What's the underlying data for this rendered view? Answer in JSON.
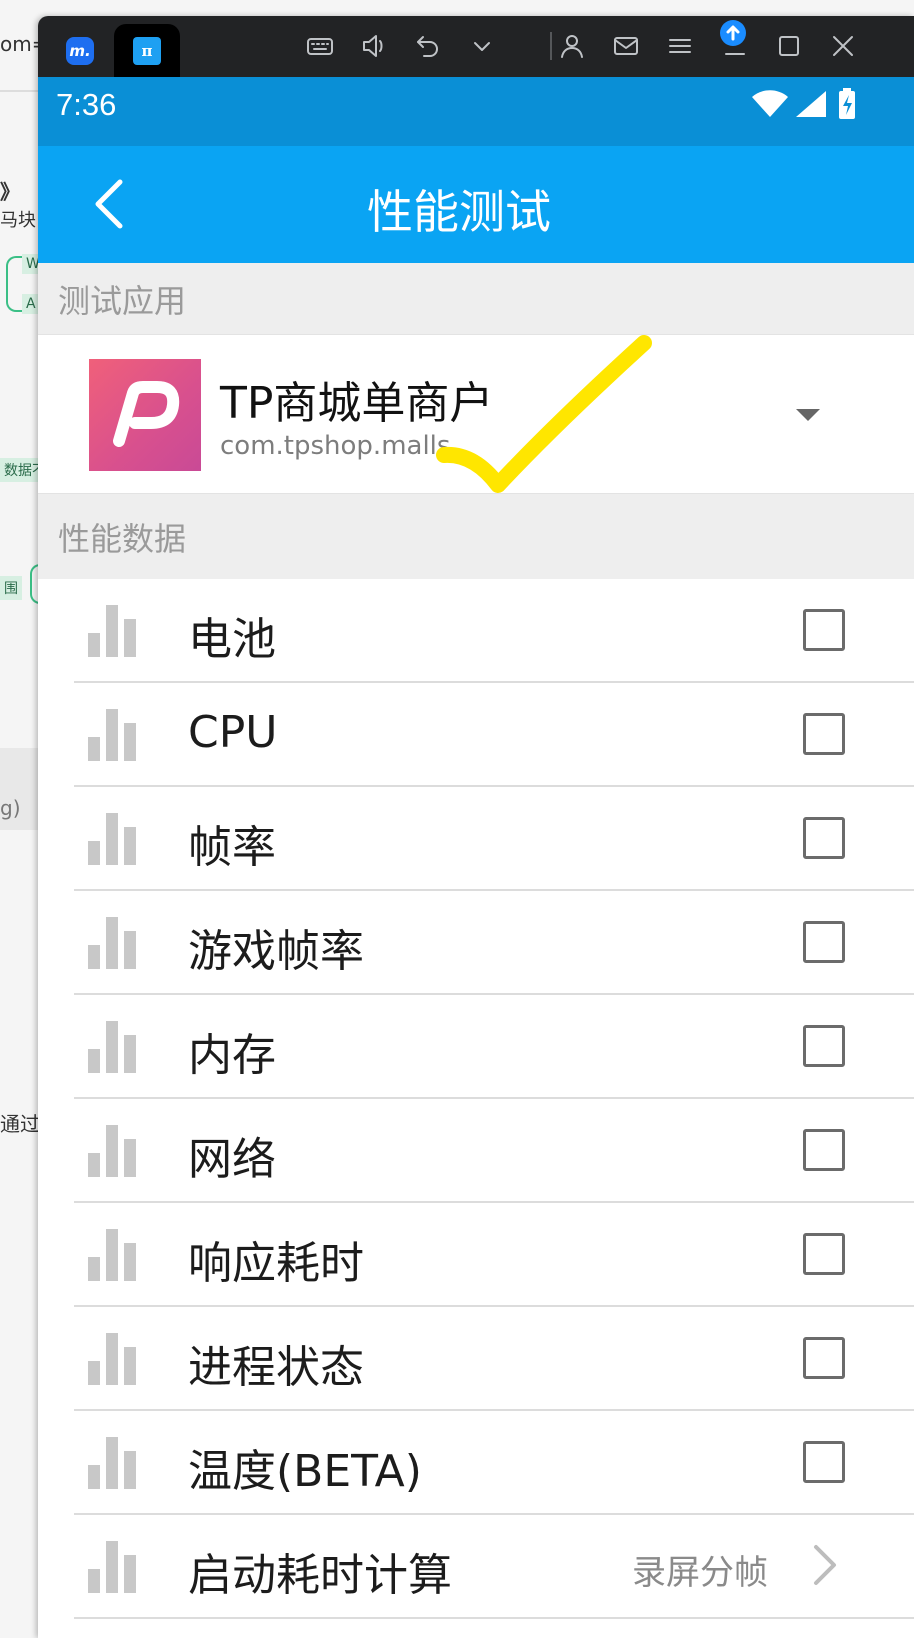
{
  "background": {
    "fragments": [
      "om=",
      "》",
      "马块",
      "W",
      "A",
      "数据不",
      "围",
      "g)",
      "通过"
    ]
  },
  "window": {
    "tabs": [
      {
        "icon": "m-app-icon",
        "glyph": "m."
      },
      {
        "icon": "pi-app-icon",
        "glyph": "π"
      }
    ],
    "toolbar_icons": [
      "keyboard-icon",
      "volume-icon",
      "undo-icon",
      "chevron-down-icon",
      "user-icon",
      "mail-icon",
      "menu-icon",
      "minimize-icon",
      "maximize-icon",
      "close-icon"
    ]
  },
  "statusbar": {
    "time": "7:36",
    "icons": [
      "wifi-icon",
      "signal-icon",
      "battery-charging-icon"
    ]
  },
  "appbar": {
    "title": "性能测试"
  },
  "app_section": {
    "header": "测试应用",
    "app_name": "TP商城单商户",
    "package": "com.tpshop.malls",
    "annotation_color": "#ffe600"
  },
  "data_section": {
    "header": "性能数据",
    "items": [
      {
        "label": "电池",
        "checked": false
      },
      {
        "label": "CPU",
        "checked": false
      },
      {
        "label": "帧率",
        "checked": false
      },
      {
        "label": "游戏帧率",
        "checked": false
      },
      {
        "label": "内存",
        "checked": false
      },
      {
        "label": "网络",
        "checked": false
      },
      {
        "label": "响应耗时",
        "checked": false
      },
      {
        "label": "进程状态",
        "checked": false
      },
      {
        "label": "温度(BETA)",
        "checked": false
      },
      {
        "label": "启动耗时计算",
        "extra": "录屏分帧"
      }
    ]
  },
  "colors": {
    "statusbar": "#0a8fd6",
    "appbar": "#0aa4f3",
    "titlebar": "#222325"
  }
}
